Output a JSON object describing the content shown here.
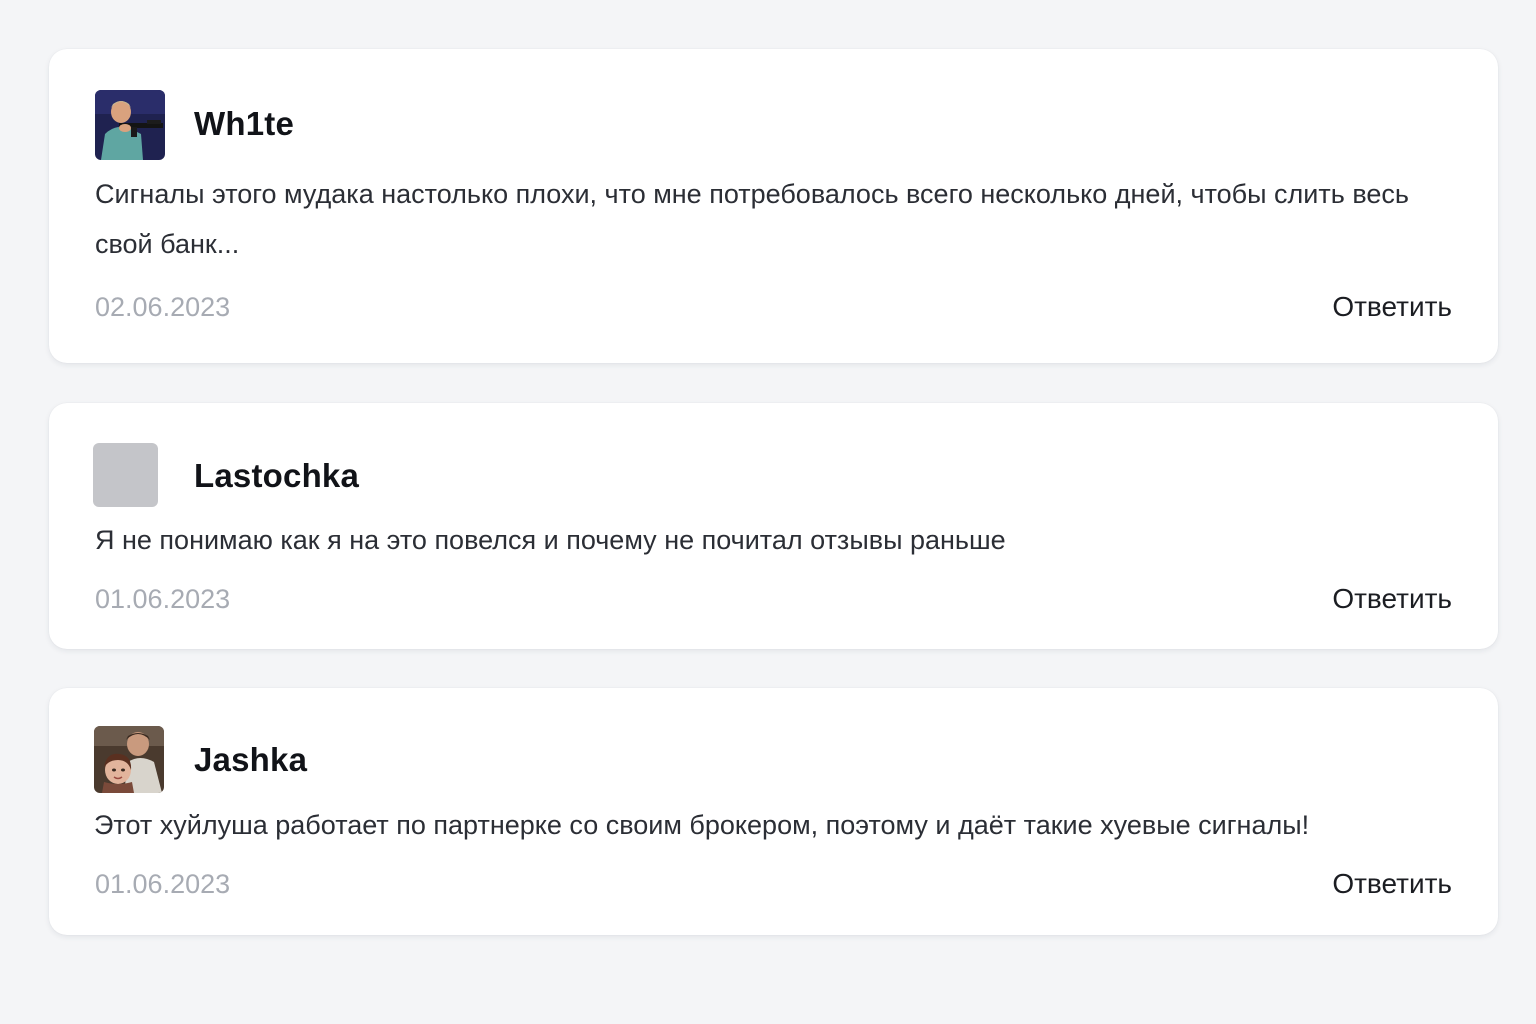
{
  "comments": [
    {
      "author": "Wh1te",
      "text": "Сигналы этого мудака настолько плохи, что мне потребовалось всего несколько дней, чтобы слить весь свой банк...",
      "date": "02.06.2023",
      "reply_label": "Ответить",
      "avatar": "photo-avatar"
    },
    {
      "author": "Lastochka",
      "text": "Я не понимаю как я на это повелся и почему не почитал отзывы раньше",
      "date": "01.06.2023",
      "reply_label": "Ответить",
      "avatar": "placeholder-avatar"
    },
    {
      "author": "Jashka",
      "text": "Этот хуйлуша работает по партнерке со своим брокером, поэтому и даёт такие хуевые сигналы!",
      "date": "01.06.2023",
      "reply_label": "Ответить",
      "avatar": "photo-avatar"
    }
  ],
  "colors": {
    "background": "#f4f5f7",
    "card": "#ffffff",
    "author": "#111318",
    "text": "#2b2e35",
    "date": "#a7abb3",
    "reply": "#1b1d22",
    "placeholder_avatar": "#c4c5c9"
  }
}
